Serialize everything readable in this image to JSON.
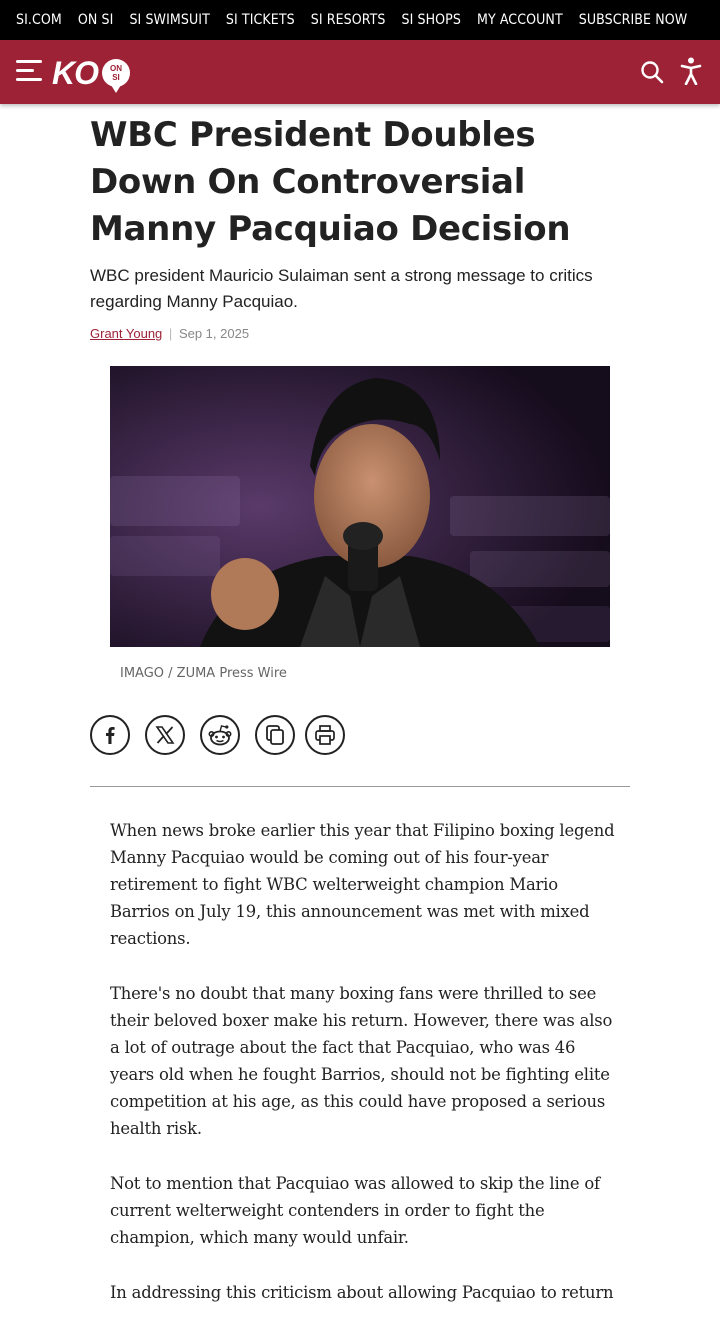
{
  "topnav": {
    "items": [
      "SI.COM",
      "ON SI",
      "SI SWIMSUIT",
      "SI TICKETS",
      "SI RESORTS",
      "SI SHOPS",
      "MY ACCOUNT",
      "SUBSCRIBE NOW"
    ]
  },
  "header": {
    "logo_text": "KO",
    "logo_badge_top": "ON",
    "logo_badge_bottom": "SI",
    "brand_color": "#9d2235"
  },
  "article": {
    "title": "WBC President Doubles Down On Controversial Manny Pacquiao Decision",
    "subtitle": "WBC president Mauricio Sulaiman sent a strong message to critics regarding Manny Pacquiao.",
    "author": "Grant Young",
    "separator": "|",
    "date": "Sep 1, 2025",
    "image_caption": "IMAGO / ZUMA Press Wire",
    "share_icons": [
      "facebook-icon",
      "x-icon",
      "reddit-icon",
      "copy-link-icon",
      "print-icon"
    ],
    "paragraphs": [
      "When news broke earlier this year that Filipino boxing legend Manny Pacquiao would be coming out of his four-year retirement to fight WBC welterweight champion Mario Barrios on July 19, this announcement was met with mixed reactions.",
      "There's no doubt that many boxing fans were thrilled to see their beloved boxer make his return. However, there was also a lot of outrage about the fact that Pacquiao, who was 46 years old when he fought Barrios, should not be fighting elite competition at his age, as this could have proposed a serious health risk.",
      "Not to mention that Pacquiao was allowed to skip the line of current welterweight contenders in order to fight the champion, which many would unfair.",
      "In addressing this criticism about allowing Pacquiao to return"
    ]
  }
}
